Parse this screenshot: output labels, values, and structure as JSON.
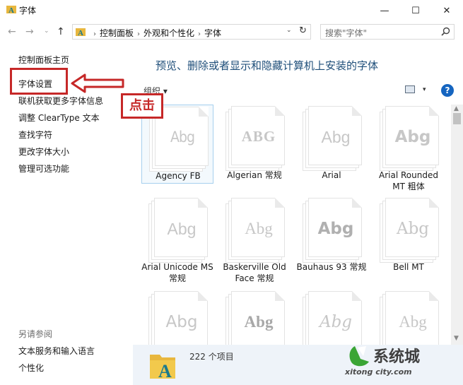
{
  "window": {
    "title": "字体",
    "minimize_glyph": "—",
    "maximize_glyph": "☐",
    "close_glyph": "✕"
  },
  "address_bar": {
    "back_glyph": "←",
    "forward_glyph": "→",
    "recent_glyph": "⌄",
    "up_glyph": "↑",
    "breadcrumbs": [
      "控制面板",
      "外观和个性化",
      "字体"
    ],
    "separator": "›",
    "dropdown_glyph": "⌄",
    "refresh_glyph": "↻",
    "search_placeholder": "搜索\"字体\""
  },
  "sidebar": {
    "links": [
      {
        "label": "控制面板主页"
      },
      {
        "label": "字体设置"
      },
      {
        "label": "联机获取更多字体信息"
      },
      {
        "label": "调整 ClearType 文本"
      },
      {
        "label": "查找字符"
      },
      {
        "label": "更改字体大小"
      },
      {
        "label": "管理可选功能"
      }
    ],
    "see_also_heading": "另请参阅",
    "see_also_links": [
      {
        "label": "文本服务和输入语言"
      },
      {
        "label": "个性化"
      }
    ]
  },
  "main": {
    "title": "预览、删除或者显示和隐藏计算机上安装的字体",
    "organize_label": "组织 ▾",
    "view_dropdown_glyph": "▾",
    "help_glyph": "?"
  },
  "fonts": [
    {
      "sample": "Abg",
      "name": "Agency FB",
      "selected": true
    },
    {
      "sample": "ABG",
      "name": "Algerian 常规",
      "selected": false
    },
    {
      "sample": "Abg",
      "name": "Arial",
      "selected": false
    },
    {
      "sample": "Abg",
      "name": "Arial Rounded MT 粗体",
      "selected": false
    },
    {
      "sample": "Abg",
      "name": "Arial Unicode MS 常规",
      "selected": false
    },
    {
      "sample": "Abg",
      "name": "Baskerville Old Face 常规",
      "selected": false
    },
    {
      "sample": "Abg",
      "name": "Bauhaus 93 常规",
      "selected": false
    },
    {
      "sample": "Abg",
      "name": "Bell MT",
      "selected": false
    },
    {
      "sample": "Abg",
      "name": "",
      "selected": false
    },
    {
      "sample": "Abg",
      "name": "",
      "selected": false
    },
    {
      "sample": "Abg",
      "name": "",
      "selected": false
    },
    {
      "sample": "Abg",
      "name": "",
      "selected": false
    }
  ],
  "scrollbar": {
    "up_glyph": "▲",
    "down_glyph": "▼"
  },
  "details": {
    "item_count": "222 个项目"
  },
  "annotation": {
    "callout_label": "点击"
  },
  "watermark": {
    "logo_chars": "系统城",
    "url_text": "xitong city.com"
  },
  "colors": {
    "accent_title": "#1e4e79",
    "annotation_red": "#c62828",
    "help_blue": "#1565c0",
    "details_bg": "#eef3f9"
  }
}
